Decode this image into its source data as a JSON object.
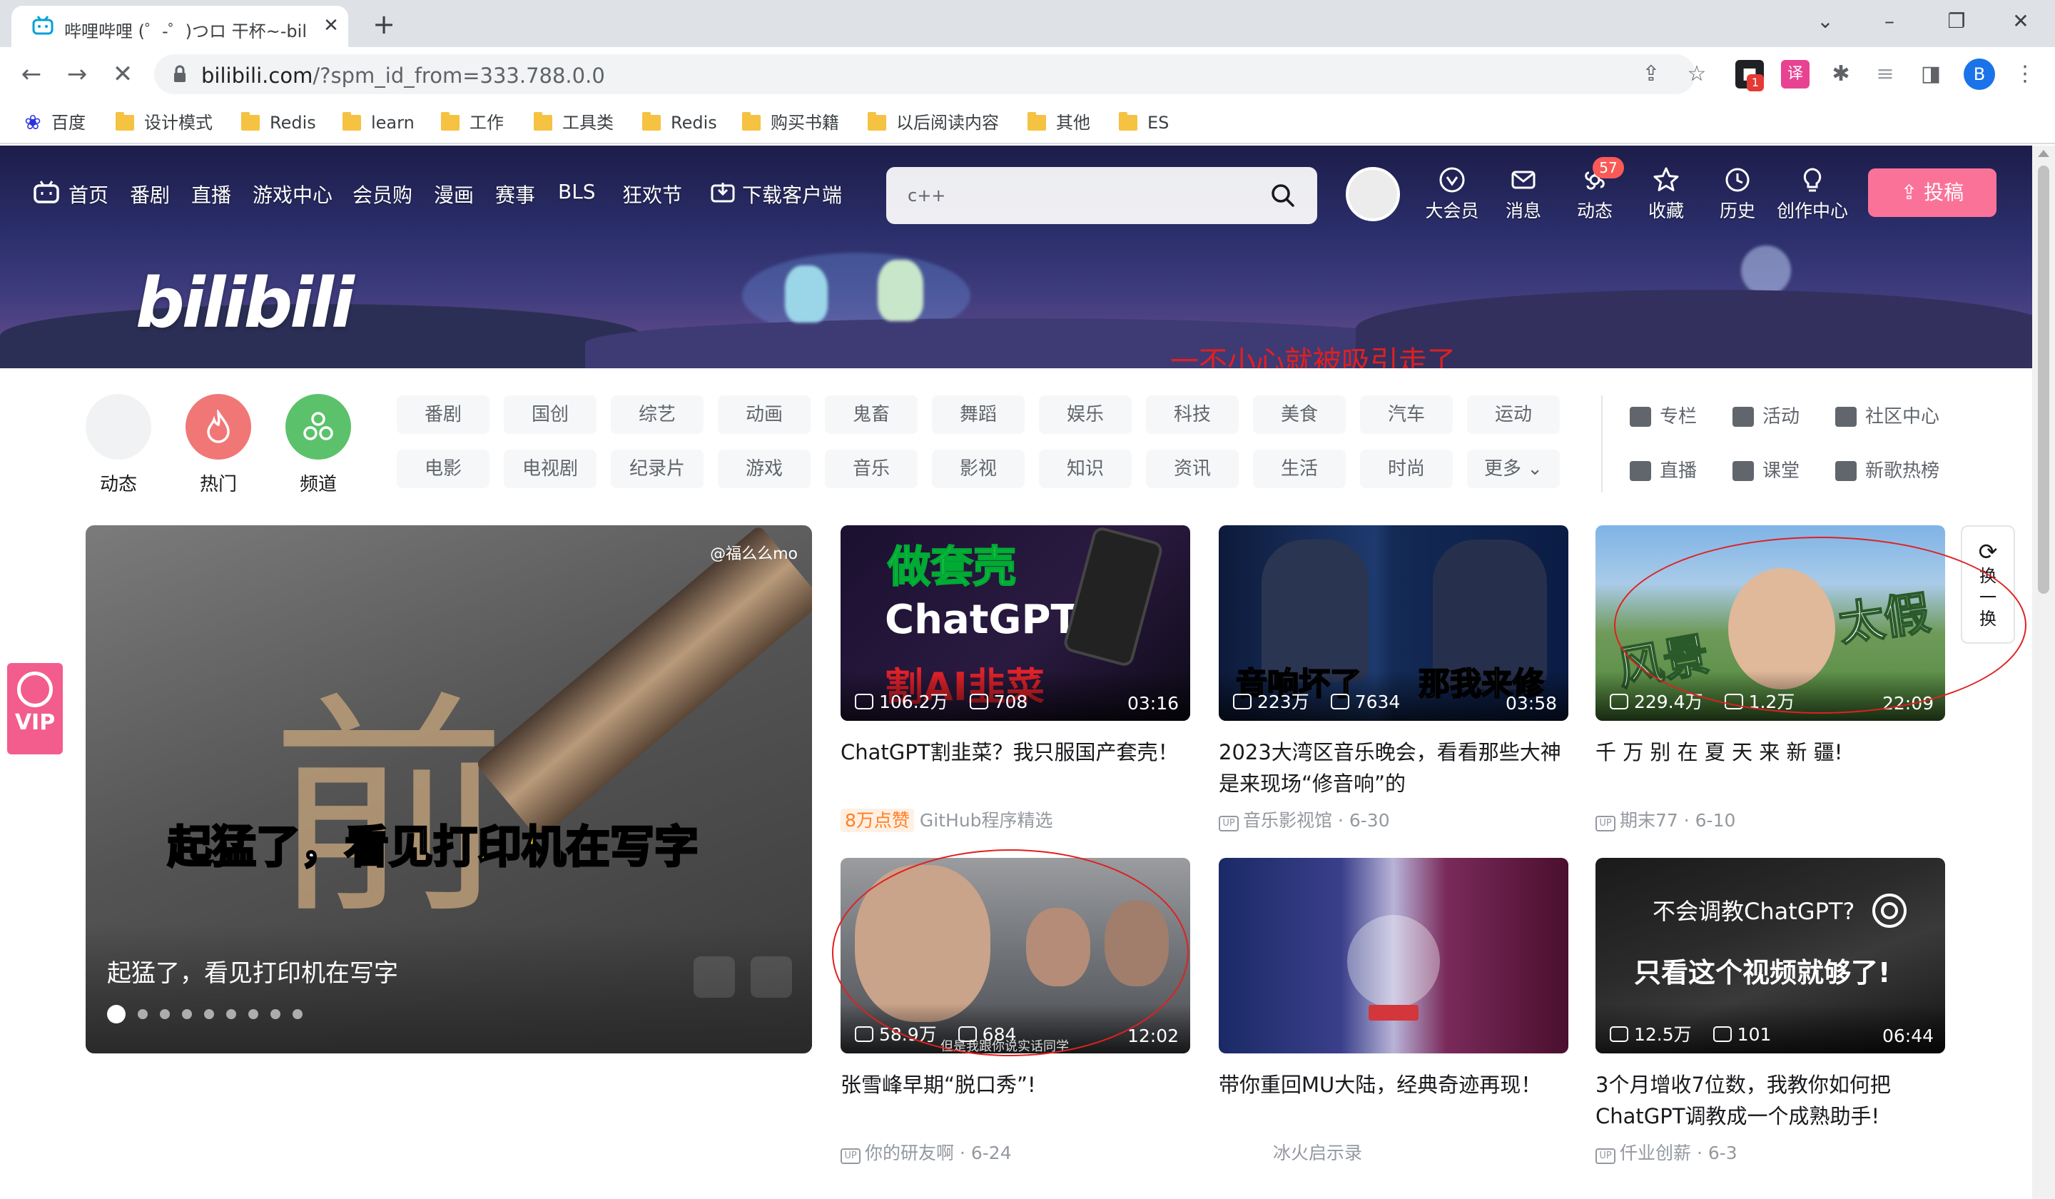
{
  "browser": {
    "tab_title": "哔哩哔哩 (゜-゜)つロ 干杯~-bilibili",
    "tab_close": "✕",
    "new_tab": "+",
    "url_host": "bilibili.com",
    "url_rest": "/?spm_id_from=333.788.0.0",
    "profile_initial": "B",
    "ext_badge": "1",
    "bookmarks": [
      "百度",
      "设计模式",
      "Redis",
      "learn",
      "工作",
      "工具类",
      "Redis",
      "购买书籍",
      "以后阅读内容",
      "其他",
      "ES"
    ]
  },
  "header": {
    "nav": [
      "首页",
      "番剧",
      "直播",
      "游戏中心",
      "会员购",
      "漫画",
      "赛事",
      "BLS",
      "狂欢节",
      "下载客户端"
    ],
    "logo": "bilibili",
    "search_placeholder": "c++",
    "right_icons": [
      "大会员",
      "消息",
      "动态",
      "收藏",
      "历史",
      "创作中心"
    ],
    "dynamic_badge": "57",
    "upload_label": "投稿",
    "banner_annotation": "一不小心就被吸引走了"
  },
  "channels": {
    "quick": [
      "动态",
      "热门",
      "频道"
    ],
    "row1": [
      "番剧",
      "国创",
      "综艺",
      "动画",
      "鬼畜",
      "舞蹈",
      "娱乐",
      "科技",
      "美食",
      "汽车",
      "运动"
    ],
    "row2": [
      "电影",
      "电视剧",
      "纪录片",
      "游戏",
      "音乐",
      "影视",
      "知识",
      "资讯",
      "生活",
      "时尚",
      "更多"
    ],
    "side": [
      "专栏",
      "活动",
      "社区中心",
      "直播",
      "课堂",
      "新歌热榜"
    ]
  },
  "carousel": {
    "caption": "起猛了，看见打印机在写字",
    "overlay_white": "起猛了，看见",
    "overlay_yellow": "打印机在写字",
    "watermark": "@福么么mo",
    "dot_count": 9,
    "active_dot": 1
  },
  "refresh": {
    "chars": [
      "换",
      "一",
      "换"
    ]
  },
  "vip_label": "VIP",
  "cards": [
    {
      "title": "ChatGPT割韭菜？我只服国产套壳！",
      "views": "106.2万",
      "danmaku": "708",
      "duration": "03:16",
      "hot": "8万点赞",
      "author": "GitHub程序精选",
      "date": "",
      "thumb_text_1": "做套壳",
      "thumb_text_2": "ChatGPT",
      "thumb_text_3": "割AI韭菜"
    },
    {
      "title": "2023大湾区音乐晚会，看看那些大神是来现场“修音响”的",
      "views": "223万",
      "danmaku": "7634",
      "duration": "03:58",
      "hot": "",
      "author": "音乐影视馆",
      "date": "6-30",
      "thumb_text_1": "音响坏了",
      "thumb_text_2": "那我来修",
      "thumb_text_3": ""
    },
    {
      "title": "千 万 别 在 夏 天 来 新 疆!",
      "views": "229.4万",
      "danmaku": "1.2万",
      "duration": "22:09",
      "hot": "",
      "author": "期末77",
      "date": "6-10",
      "thumb_text_1": "风景",
      "thumb_text_2": "太假",
      "thumb_text_3": ""
    },
    {
      "title": "张雪峰早期“脱口秀”!",
      "views": "58.9万",
      "danmaku": "684",
      "duration": "12:02",
      "hot": "",
      "author": "你的研友啊",
      "date": "6-24",
      "thumb_text_1": "但是我跟你说实话同学",
      "thumb_text_2": "",
      "thumb_text_3": ""
    },
    {
      "title": "带你重回MU大陆，经典奇迹再现！",
      "views": "",
      "danmaku": "",
      "duration": "",
      "hot": "",
      "author": "冰火启示录",
      "date": "",
      "thumb_text_1": "",
      "thumb_text_2": "",
      "thumb_text_3": ""
    },
    {
      "title": "3个月增收7位数，我教你如何把ChatGPT调教成一个成熟助手!",
      "views": "12.5万",
      "danmaku": "101",
      "duration": "06:44",
      "hot": "",
      "author": "仟业创薪",
      "date": "6-3",
      "thumb_text_1": "不会调教ChatGPT?",
      "thumb_text_2": "只看这个视频就够了!",
      "thumb_text_3": ""
    }
  ],
  "colors": {
    "accent_pink": "#fb7299",
    "hot_orange": "#ff7f24",
    "annotation_red": "#e02020"
  }
}
